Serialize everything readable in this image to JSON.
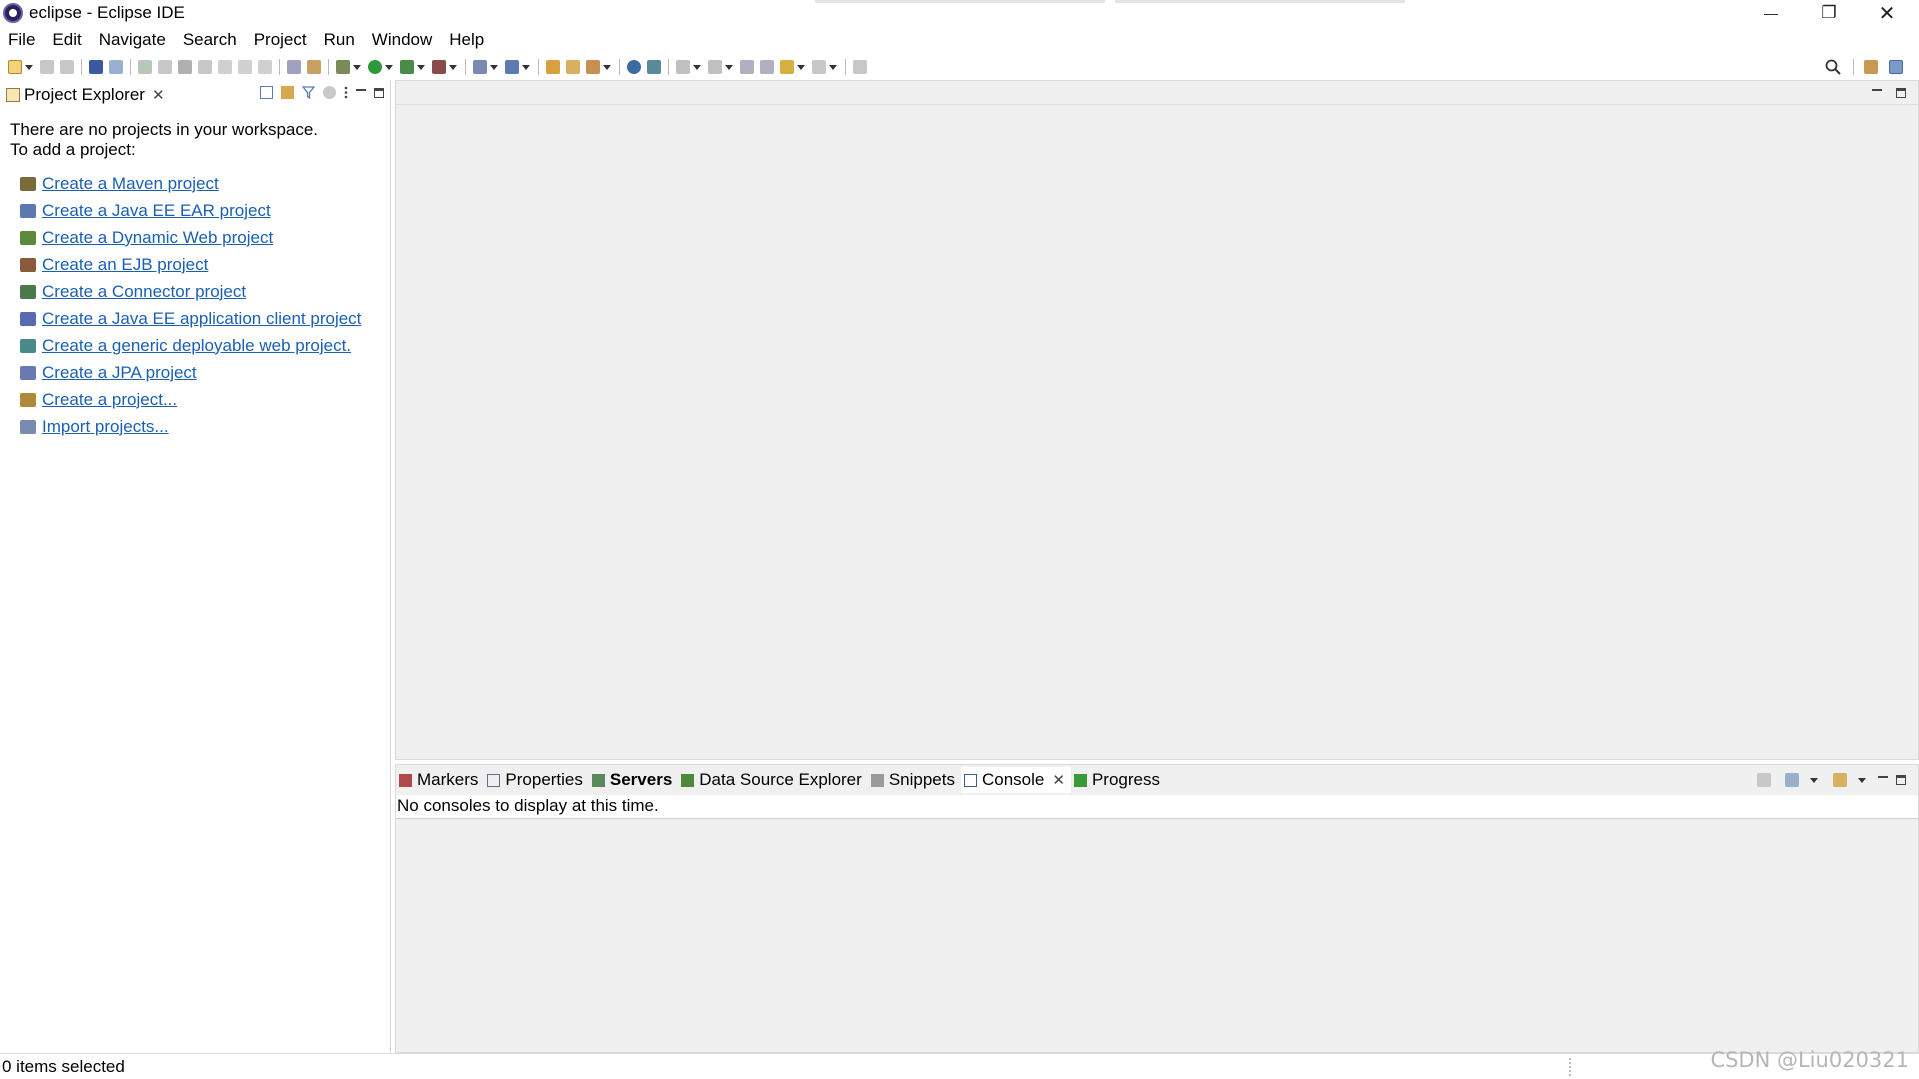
{
  "window": {
    "title": "eclipse - Eclipse IDE",
    "controls": {
      "minimize": "—",
      "restore": "❐",
      "close": "✕"
    }
  },
  "menu": [
    "File",
    "Edit",
    "Navigate",
    "Search",
    "Project",
    "Run",
    "Window",
    "Help"
  ],
  "project_explorer": {
    "tab_label": "Project Explorer",
    "close_glyph": "✕",
    "message_line1": "There are no projects in your workspace.",
    "message_line2": "To add a project:",
    "links": [
      {
        "label": "Create a Maven project",
        "icon": "maven-project-icon",
        "color": "#7a6c3a"
      },
      {
        "label": "Create a Java EE EAR project",
        "icon": "ear-project-icon",
        "color": "#5a7ab0"
      },
      {
        "label": "Create a Dynamic Web project",
        "icon": "web-project-icon",
        "color": "#5b8a3a"
      },
      {
        "label": "Create an EJB project",
        "icon": "ejb-project-icon",
        "color": "#8a5a3a"
      },
      {
        "label": "Create a Connector project",
        "icon": "connector-project-icon",
        "color": "#4a7a4a"
      },
      {
        "label": "Create a Java EE application client project",
        "icon": "appclient-project-icon",
        "color": "#5a6ab0"
      },
      {
        "label": "Create a generic deployable web project.",
        "icon": "generic-web-project-icon",
        "color": "#4a8a8a"
      },
      {
        "label": "Create a JPA project",
        "icon": "jpa-project-icon",
        "color": "#6a7ab0"
      },
      {
        "label": "Create a project...",
        "icon": "new-project-icon",
        "color": "#b08a3a"
      },
      {
        "label": "Import projects...",
        "icon": "import-projects-icon",
        "color": "#7a8ab0"
      }
    ]
  },
  "bottom_panel": {
    "tabs": [
      {
        "label": "Markers",
        "icon": "markers-icon",
        "color": "#b04a4a"
      },
      {
        "label": "Properties",
        "icon": "properties-icon",
        "color": "#6a6a8a"
      },
      {
        "label": "Servers",
        "icon": "servers-icon",
        "color": "#5a8a5a",
        "bold": true
      },
      {
        "label": "Data Source Explorer",
        "icon": "data-source-icon",
        "color": "#4a8a3a"
      },
      {
        "label": "Snippets",
        "icon": "snippets-icon",
        "color": "#7a7a7a"
      },
      {
        "label": "Console",
        "icon": "console-icon",
        "color": "#3a5aa0",
        "active": true,
        "closable": true
      },
      {
        "label": "Progress",
        "icon": "progress-icon",
        "color": "#3a9a3a"
      }
    ],
    "console_message": "No consoles to display at this time.",
    "close_glyph": "✕"
  },
  "status": {
    "text": "0 items selected"
  },
  "watermark": "CSDN @Liu020321",
  "toolbar_icons": [
    "new-icon",
    "save-icon",
    "save-all-icon",
    "console-icon",
    "skip-breakpoints-icon",
    "resume-icon",
    "suspend-icon",
    "terminate-icon",
    "disconnect-icon",
    "step-into-icon",
    "step-over-icon",
    "step-return-icon",
    "word-wrap-icon",
    "use-step-filters-icon",
    "debug-icon",
    "run-icon",
    "coverage-icon",
    "external-tools-icon",
    "new-server-icon",
    "new-jee-icon",
    "open-type-icon",
    "open-task-icon",
    "search-tool-icon",
    "browser-icon",
    "publish-icon",
    "next-annotation-icon",
    "prev-annotation-icon",
    "last-edit-icon",
    "back-icon",
    "forward-icon",
    "pin-editor-icon"
  ]
}
